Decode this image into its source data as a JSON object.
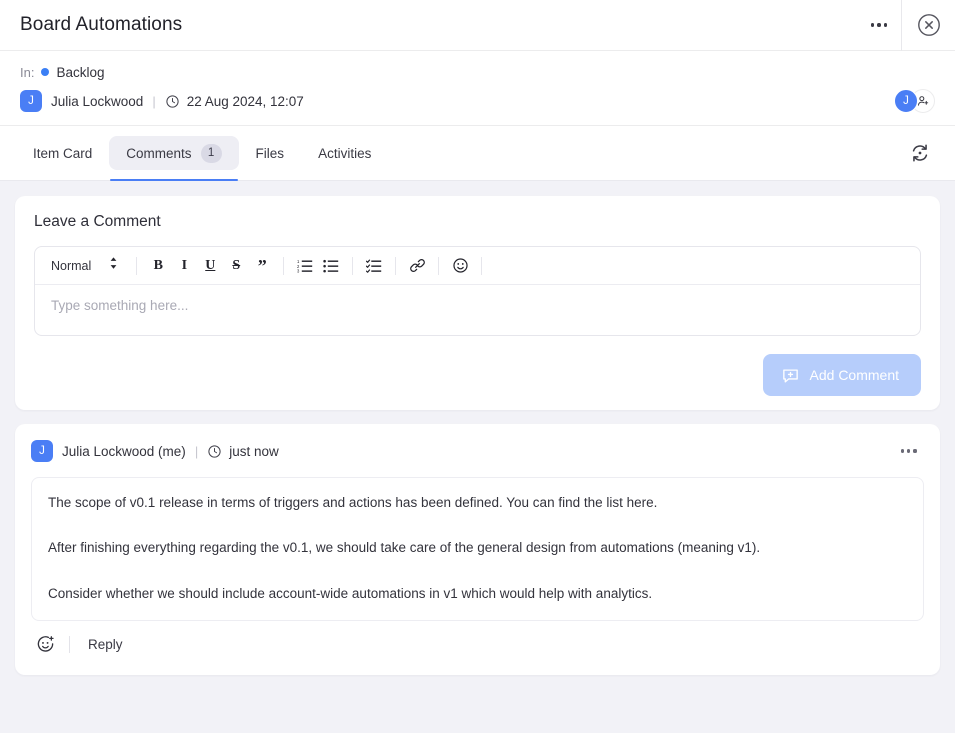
{
  "window": {
    "title": "Board Automations",
    "more_icon": "ellipsis-icon",
    "close_icon": "close-circle-icon"
  },
  "meta": {
    "in_label": "In:",
    "status": "Backlog",
    "status_color": "#3b7ff5",
    "author_initial": "J",
    "author": "Julia Lockwood",
    "separator": "|",
    "clock_icon": "clock-icon",
    "timestamp": "22 Aug 2024, 12:07",
    "watcher_initial": "J",
    "add_user_icon": "add-user-icon"
  },
  "tabs": {
    "items": [
      {
        "label": "Item Card",
        "badge": "",
        "active": false
      },
      {
        "label": "Comments",
        "badge": "1",
        "active": true
      },
      {
        "label": "Files",
        "badge": "",
        "active": false
      },
      {
        "label": "Activities",
        "badge": "",
        "active": false
      }
    ],
    "refresh_icon": "sync-icon"
  },
  "composer": {
    "title": "Leave a Comment",
    "toolbar": {
      "format_label": "Normal",
      "chevron_icon": "chevron-updown-icon",
      "bold": "B",
      "italic": "I",
      "underline": "U",
      "strike": "S",
      "quote": "”",
      "ordered_list_icon": "ordered-list-icon",
      "bullet_list_icon": "bullet-list-icon",
      "check_list_icon": "check-list-icon",
      "link_icon": "link-icon",
      "emoji_icon": "emoji-icon"
    },
    "placeholder": "Type something here...",
    "value": "",
    "submit_label": "Add Comment",
    "submit_icon": "add-comment-icon",
    "submit_color": "#b6cdfb"
  },
  "comment": {
    "avatar_initial": "J",
    "author": "Julia Lockwood (me)",
    "separator": "|",
    "clock_icon": "clock-icon",
    "time": "just now",
    "menu_icon": "ellipsis-icon",
    "paragraphs": [
      "The scope of v0.1 release in terms of triggers and actions has been defined. You can find the list here.",
      "After finishing everything regarding the v0.1, we should take care of the general design from automations (meaning v1).",
      "Consider whether we should include account-wide automations in v1 which would help with analytics."
    ],
    "react_icon": "add-reaction-icon",
    "reply_label": "Reply"
  }
}
